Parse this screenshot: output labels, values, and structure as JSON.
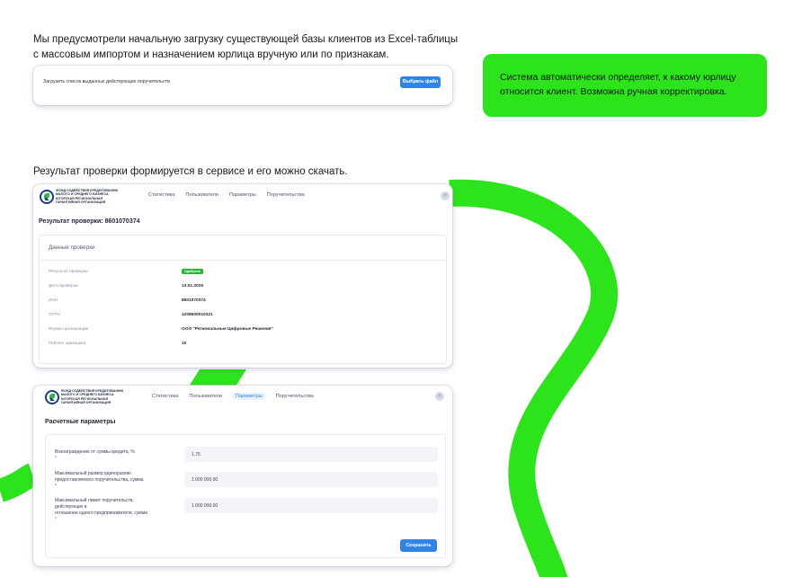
{
  "intro": {
    "line1": "Мы предусмотрели начальную загрузку существующей базы клиентов из Excel-таблицы",
    "line2": "с массовым импортом и назначением юрлица вручную или по признакам."
  },
  "upload": {
    "label": "Загрузить список выданных действующих поручительств",
    "button": "Выбрать файл"
  },
  "note": {
    "line1": "Система автоматически определяет, к какому юрлицу",
    "line2": "относится клиент. Возможна ручная корректировка."
  },
  "result_caption": "Результат проверки формируется в сервисе и его можно скачать.",
  "app": {
    "logo_lines": [
      "ФОНД СОДЕЙСТВИЯ КРЕДИТОВАНИЮ",
      "МАЛОГО И СРЕДНЕГО БИЗНЕСА",
      "ЮГОРСКАЯ РЕГИОНАЛЬНАЯ",
      "ГАРАНТИЙНАЯ ОРГАНИЗАЦИЯ"
    ],
    "nav": [
      "Статистика",
      "Пользователи",
      "Параметры",
      "Поручительства"
    ]
  },
  "result": {
    "title": "Результат проверки: 8601070374",
    "panel_title": "Данные проверки",
    "rows": [
      {
        "label": "Результат проверки",
        "value": "Одобрено"
      },
      {
        "label": "Дата проверки",
        "value": "13.01.2025"
      },
      {
        "label": "ИНН",
        "value": "8601070374"
      },
      {
        "label": "ОГРН",
        "value": "1208600010321"
      },
      {
        "label": "Форма организации",
        "value": "ООО \"Региональные Цифровые Решения\""
      },
      {
        "label": "Рейтинг заемщика",
        "value": "10"
      }
    ]
  },
  "params": {
    "title": "Расчетные параметры",
    "fields": [
      {
        "label_lines": [
          "Вознаграждение от суммы кредита, %"
        ],
        "value": "1.75"
      },
      {
        "label_lines": [
          "Максимальный размер единоразово",
          "предоставляемого поручительства, сумма"
        ],
        "value": "1 000 000.00"
      },
      {
        "label_lines": [
          "Максимальный лимит поручительств, действующих в",
          "отношении одного предпринимателя, сумма"
        ],
        "value": "1 000 000.00"
      }
    ],
    "save_button": "Сохранить"
  },
  "colors": {
    "accent_green": "#2de31c",
    "primary_blue": "#2f84e6",
    "badge_green": "#27b33a"
  }
}
